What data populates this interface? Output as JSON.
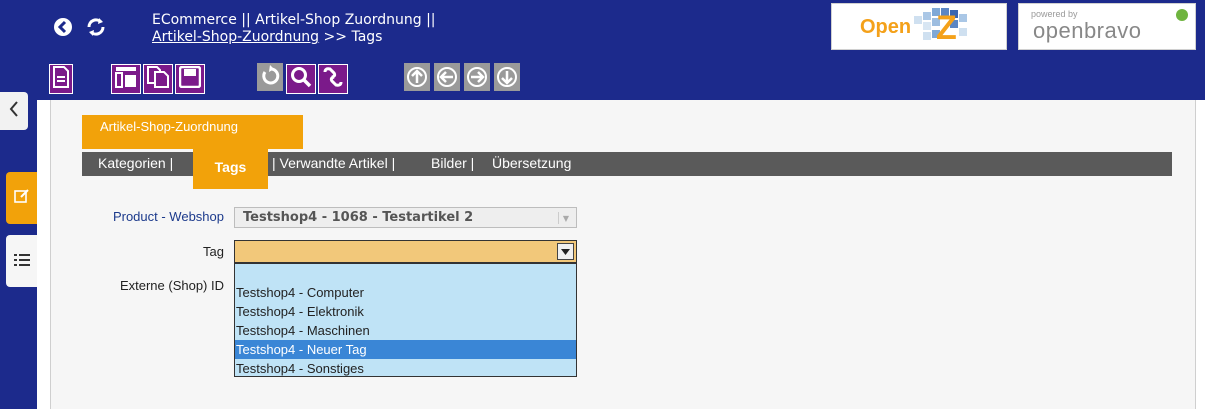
{
  "header": {
    "breadcrumb_line1": "ECommerce || Artikel-Shop Zuordnung ||",
    "breadcrumb_link": "Artikel-Shop-Zuordnung",
    "breadcrumb_sep": " >> ",
    "breadcrumb_current": "Tags",
    "logo_openz_text": "Open",
    "logo_openz_letter": "Z",
    "logo_ob_powered": "powered by",
    "logo_ob_brand": "openbravo"
  },
  "toolbar": {
    "buttons": [
      "new-document",
      "grid-view",
      "copy-record",
      "save",
      "undo",
      "search",
      "link",
      "first",
      "previous",
      "next",
      "last"
    ]
  },
  "window_tab": {
    "label": "Artikel-Shop-Zuordnung"
  },
  "subtabs": {
    "kategorien": "Kategorien |",
    "tags": "Tags",
    "verwandte": "| Verwandte Artikel |",
    "bilder": "Bilder |",
    "uebersetzung": "Übersetzung"
  },
  "form": {
    "product_webshop_label": "Product - Webshop",
    "product_webshop_value": "Testshop4 - 1068 - Testartikel 2",
    "tag_label": "Tag",
    "tag_value": "",
    "external_id_label": "Externe (Shop) ID"
  },
  "dropdown": {
    "options": [
      "",
      "Testshop4 - Computer",
      "Testshop4 - Elektronik",
      "Testshop4 - Maschinen",
      "Testshop4 - Neuer Tag",
      "Testshop4 - Sonstiges"
    ],
    "selected": "Testshop4 - Neuer Tag"
  },
  "colors": {
    "navy": "#1c2a8c",
    "orange": "#f2a20a",
    "purple": "#7b1a8a",
    "dropdown_bg": "#bfe3f6",
    "selected_bg": "#3a86d6"
  }
}
